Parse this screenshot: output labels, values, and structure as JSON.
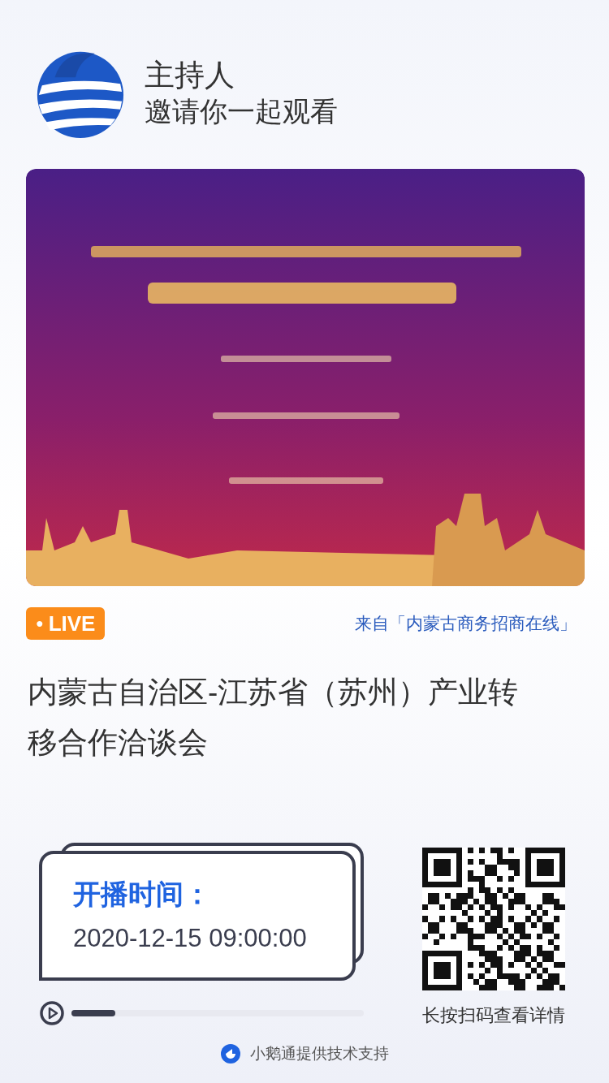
{
  "header": {
    "title": "主持人",
    "subtitle": "邀请你一起观看"
  },
  "live_badge": {
    "icon": "●",
    "label": "LIVE"
  },
  "source": "来自「内蒙古商务招商在线」",
  "event_title": "内蒙古自治区-江苏省（苏州）产业转移合作洽谈会",
  "schedule": {
    "label": "开播时间：",
    "time": "2020-12-15 09:00:00"
  },
  "progress": {
    "level": 0.15
  },
  "qr": {
    "caption": "长按扫码查看详情"
  },
  "footer": "小鹅通提供技术支持"
}
